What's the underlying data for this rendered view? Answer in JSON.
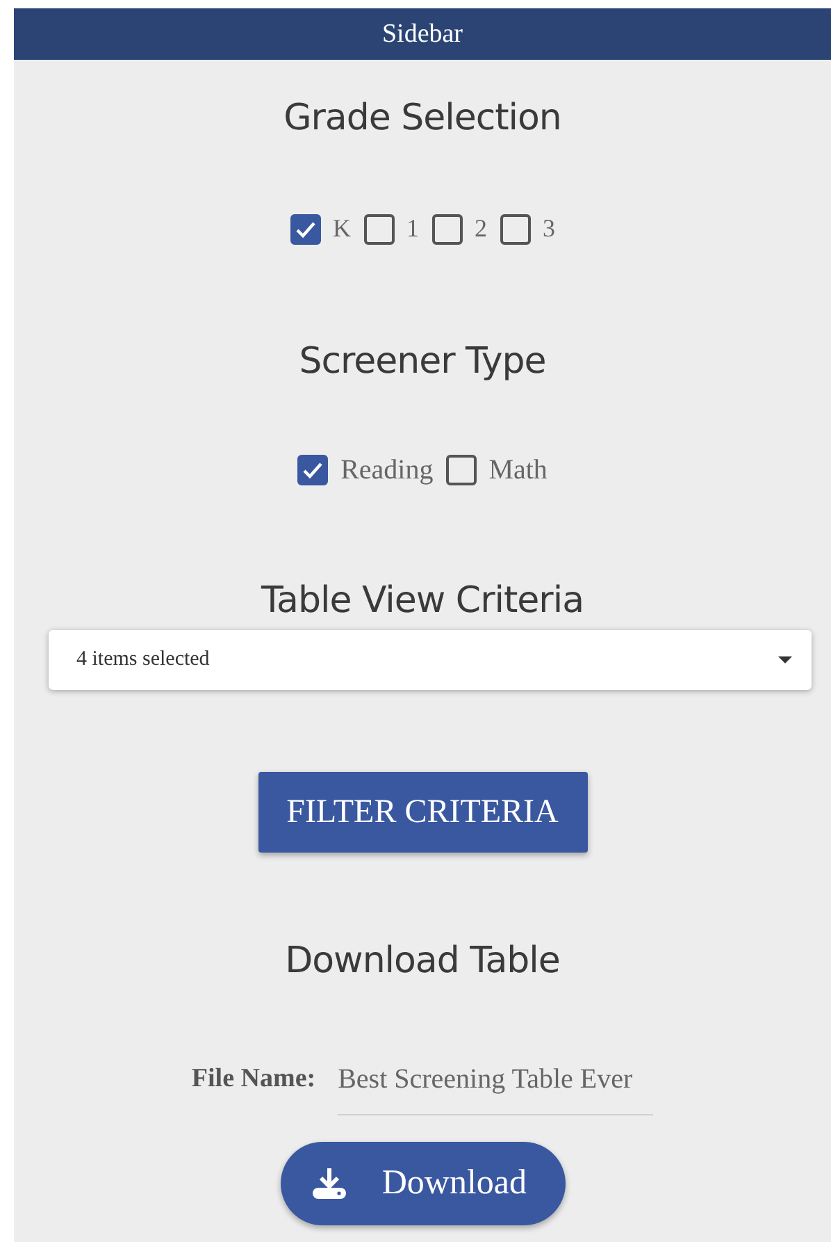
{
  "header": {
    "title": "Sidebar"
  },
  "sections": [
    {
      "kind": "checkboxes",
      "heading": "Grade Selection",
      "options": [
        {
          "label": "K",
          "checked": true
        },
        {
          "label": "1",
          "checked": false
        },
        {
          "label": "2",
          "checked": false
        },
        {
          "label": "3",
          "checked": false
        }
      ]
    },
    {
      "kind": "checkboxes",
      "heading": "Screener Type",
      "options": [
        {
          "label": "Reading",
          "checked": true
        },
        {
          "label": "Math",
          "checked": false
        }
      ]
    },
    {
      "kind": "dropdown",
      "heading": "Table View Criteria",
      "value": "4 items selected",
      "button": "FILTER CRITERIA"
    },
    {
      "kind": "download",
      "heading": "Download Table",
      "field_label": "File Name:",
      "value": "Best Screening Table Ever",
      "button": "Download"
    }
  ]
}
